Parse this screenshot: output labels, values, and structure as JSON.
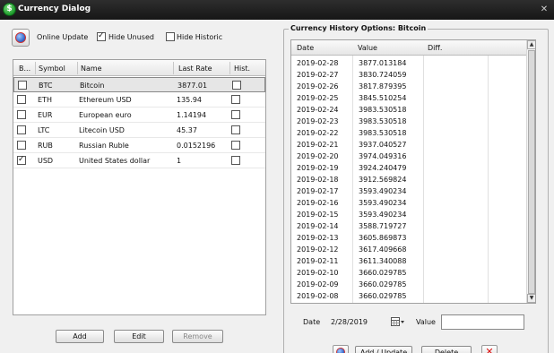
{
  "window": {
    "title": "Currency Dialog",
    "close_glyph": "✕"
  },
  "toolbar": {
    "online_update_label": "Online Update",
    "hide_unused_label": "Hide Unused",
    "hide_unused_checked": true,
    "hide_historic_label": "Hide Historic",
    "hide_historic_checked": false
  },
  "currencies": {
    "columns": [
      "B...",
      "Symbol",
      "Name",
      "Last Rate",
      "Hist."
    ],
    "rows": [
      {
        "base": false,
        "symbol": "BTC",
        "name": "Bitcoin",
        "rate": "3877.01",
        "hist": false,
        "selected": true
      },
      {
        "base": false,
        "symbol": "ETH",
        "name": "Ethereum USD",
        "rate": "135.94",
        "hist": false,
        "selected": false
      },
      {
        "base": false,
        "symbol": "EUR",
        "name": "European euro",
        "rate": "1.14194",
        "hist": false,
        "selected": false
      },
      {
        "base": false,
        "symbol": "LTC",
        "name": "Litecoin USD",
        "rate": "45.37",
        "hist": false,
        "selected": false
      },
      {
        "base": false,
        "symbol": "RUB",
        "name": "Russian Ruble",
        "rate": "0.0152196",
        "hist": false,
        "selected": false
      },
      {
        "base": true,
        "symbol": "USD",
        "name": "United States dollar",
        "rate": "1",
        "hist": false,
        "selected": false
      }
    ]
  },
  "buttons": {
    "add": "Add",
    "edit": "Edit",
    "remove": "Remove",
    "add_update": "Add / Update",
    "delete": "Delete"
  },
  "history": {
    "group_title": "Currency History Options: Bitcoin",
    "columns": [
      "Date",
      "Value",
      "Diff."
    ],
    "rows": [
      [
        "2019-02-28",
        "3877.013184"
      ],
      [
        "2019-02-27",
        "3830.724059"
      ],
      [
        "2019-02-26",
        "3817.879395"
      ],
      [
        "2019-02-25",
        "3845.510254"
      ],
      [
        "2019-02-24",
        "3983.530518"
      ],
      [
        "2019-02-23",
        "3983.530518"
      ],
      [
        "2019-02-22",
        "3983.530518"
      ],
      [
        "2019-02-21",
        "3937.040527"
      ],
      [
        "2019-02-20",
        "3974.049316"
      ],
      [
        "2019-02-19",
        "3924.240479"
      ],
      [
        "2019-02-18",
        "3912.569824"
      ],
      [
        "2019-02-17",
        "3593.490234"
      ],
      [
        "2019-02-16",
        "3593.490234"
      ],
      [
        "2019-02-15",
        "3593.490234"
      ],
      [
        "2019-02-14",
        "3588.719727"
      ],
      [
        "2019-02-13",
        "3605.869873"
      ],
      [
        "2019-02-12",
        "3617.409668"
      ],
      [
        "2019-02-11",
        "3611.340088"
      ],
      [
        "2019-02-10",
        "3660.029785"
      ],
      [
        "2019-02-09",
        "3660.029785"
      ],
      [
        "2019-02-08",
        "3660.029785"
      ]
    ]
  },
  "entry": {
    "date_label": "Date",
    "date_value": "2/28/2019",
    "value_label": "Value",
    "value_text": ""
  }
}
